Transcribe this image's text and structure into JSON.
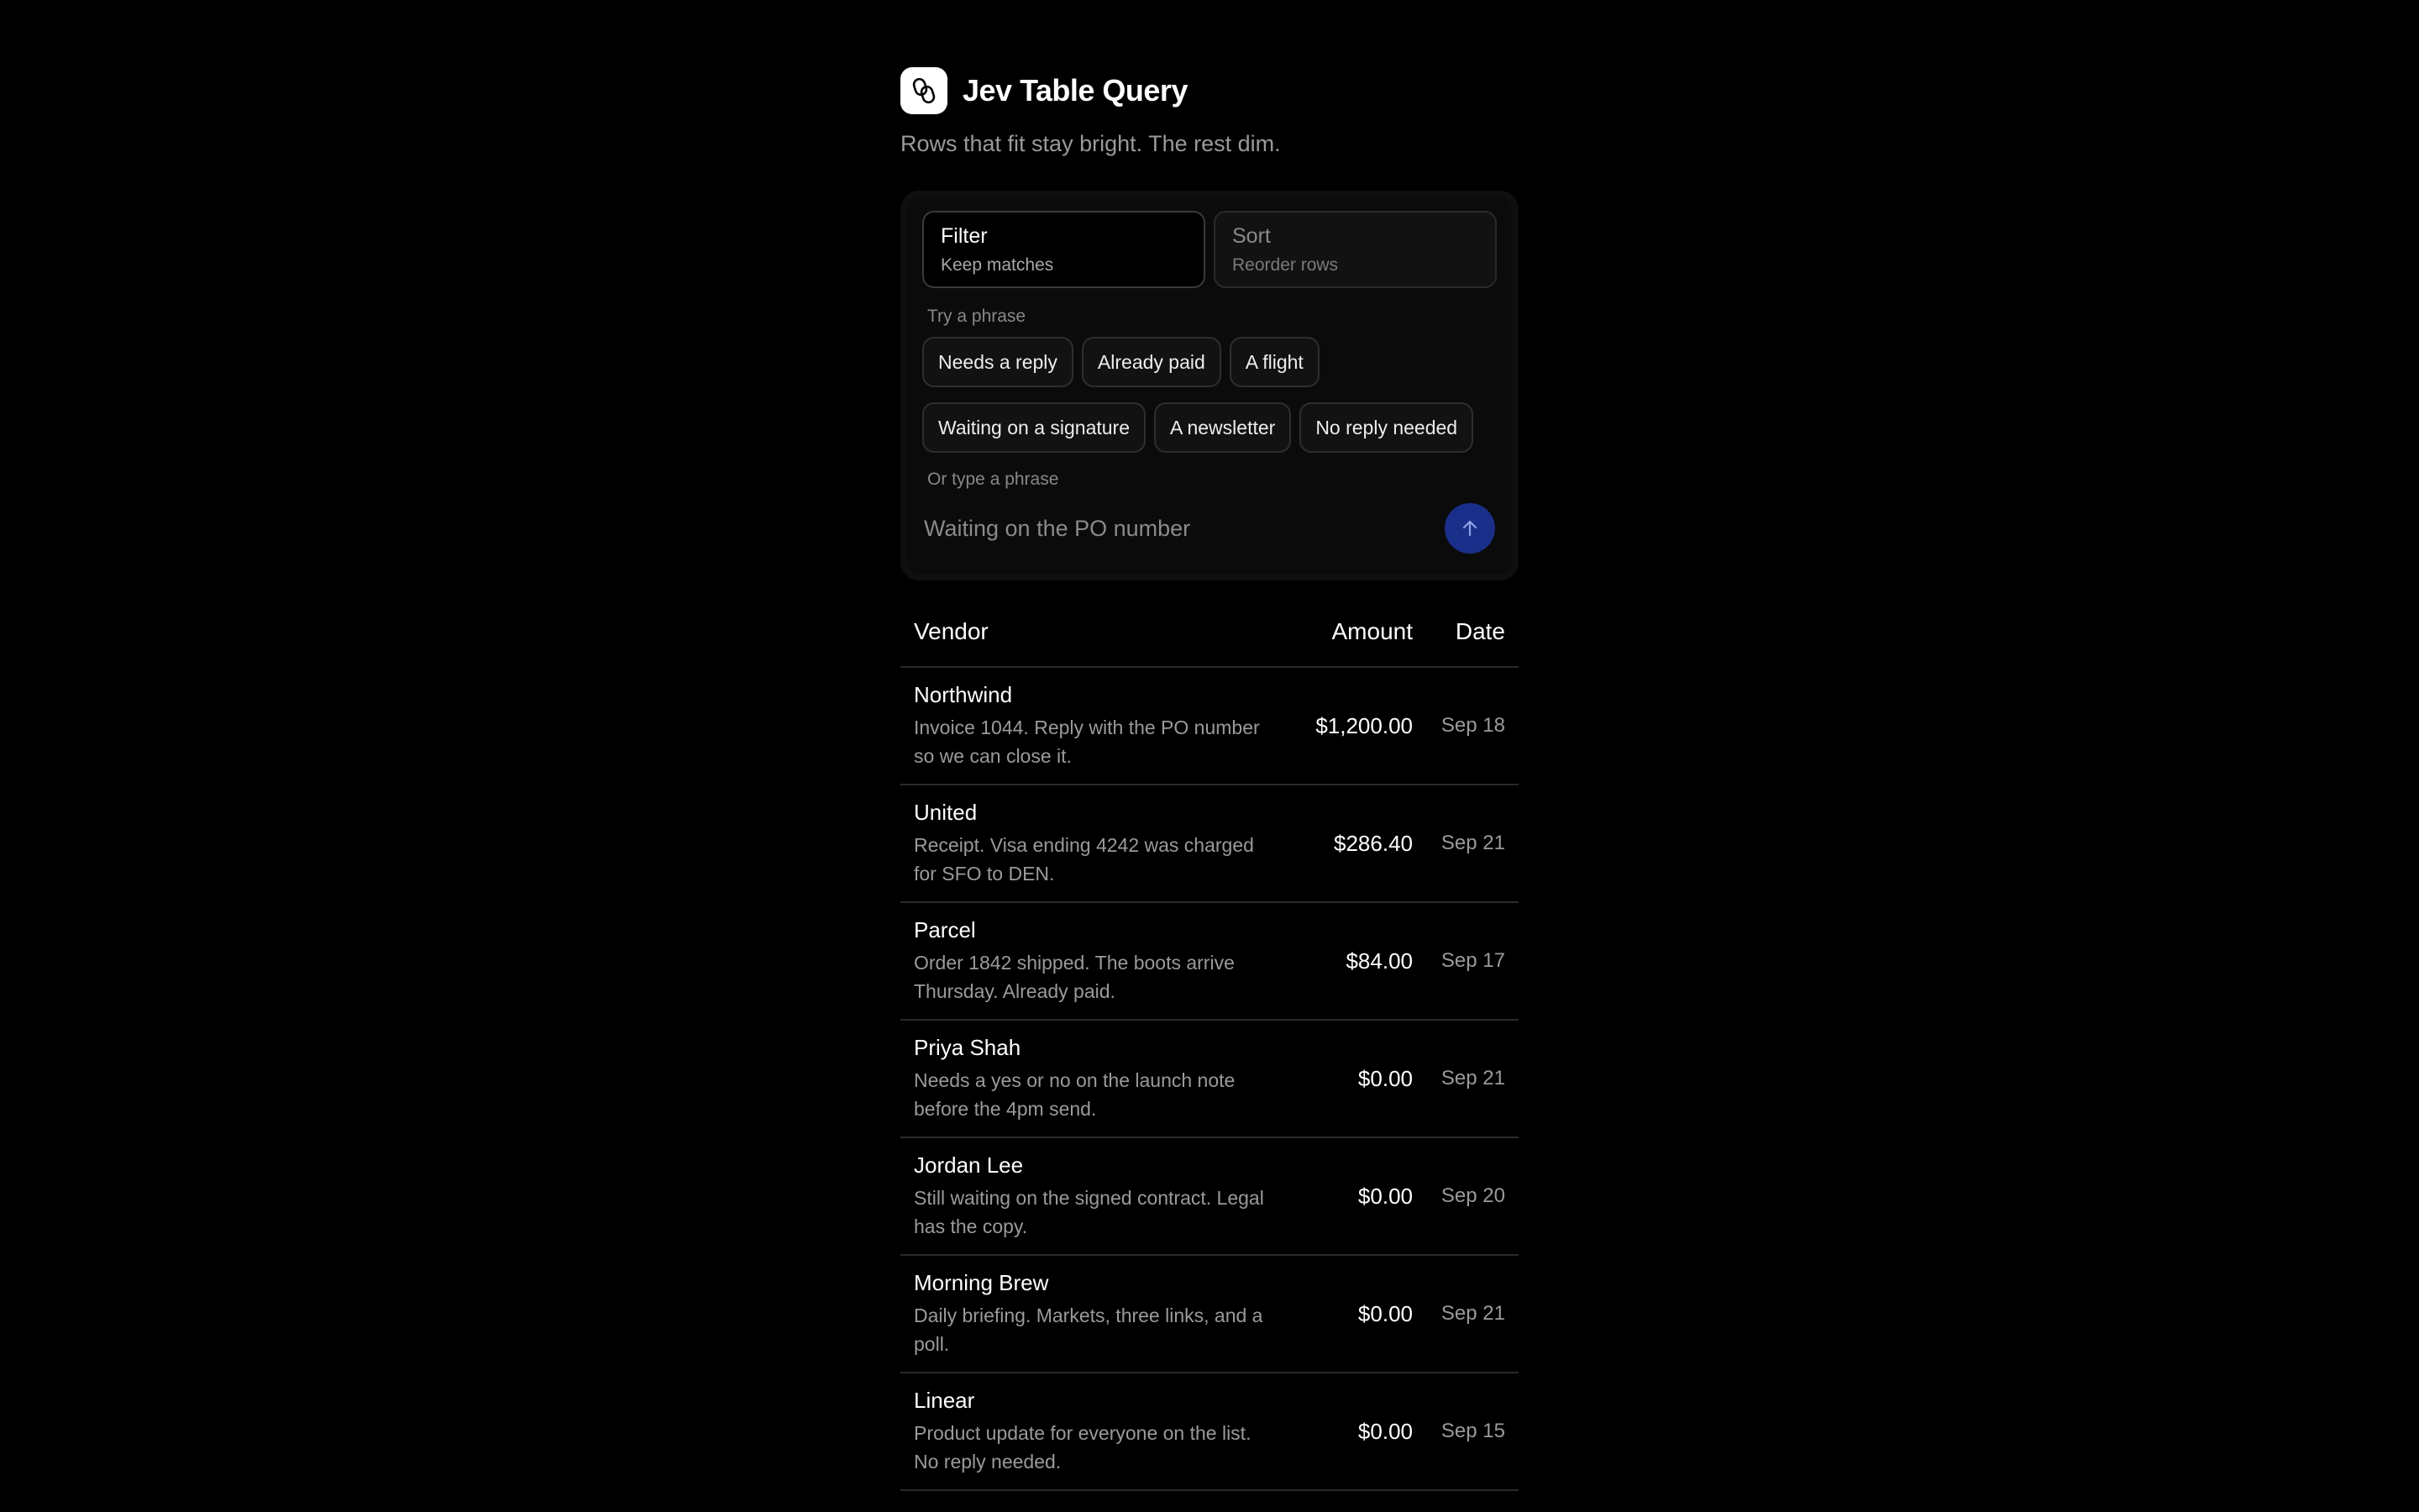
{
  "app": {
    "title": "Jev Table Query",
    "subtitle": "Rows that fit stay bright. The rest dim.",
    "logo_icon": "link-icon"
  },
  "modes": [
    {
      "label": "Filter",
      "sub": "Keep matches",
      "active": true
    },
    {
      "label": "Sort",
      "sub": "Reorder rows",
      "active": false
    }
  ],
  "phrases": {
    "label": "Try a phrase",
    "row1": [
      "Needs a reply",
      "Already paid",
      "A flight"
    ],
    "row2": [
      "Waiting on a signature",
      "A newsletter",
      "No reply needed"
    ]
  },
  "input": {
    "label": "Or type a phrase",
    "placeholder": "Waiting on the PO number",
    "value": "",
    "send_icon": "arrow-up-icon",
    "send_color": "#1a2f8a"
  },
  "table": {
    "headers": {
      "vendor": "Vendor",
      "amount": "Amount",
      "date": "Date"
    },
    "rows": [
      {
        "vendor": "Northwind",
        "desc": "Invoice 1044. Reply with the PO number so we can close it.",
        "amount": "$1,200.00",
        "date": "Sep 18"
      },
      {
        "vendor": "United",
        "desc": "Receipt. Visa ending 4242 was charged for SFO to DEN.",
        "amount": "$286.40",
        "date": "Sep 21"
      },
      {
        "vendor": "Parcel",
        "desc": "Order 1842 shipped. The boots arrive Thursday. Already paid.",
        "amount": "$84.00",
        "date": "Sep 17"
      },
      {
        "vendor": "Priya Shah",
        "desc": "Needs a yes or no on the launch note before the 4pm send.",
        "amount": "$0.00",
        "date": "Sep 21"
      },
      {
        "vendor": "Jordan Lee",
        "desc": "Still waiting on the signed contract. Legal has the copy.",
        "amount": "$0.00",
        "date": "Sep 20"
      },
      {
        "vendor": "Morning Brew",
        "desc": "Daily briefing. Markets, three links, and a poll.",
        "amount": "$0.00",
        "date": "Sep 21"
      },
      {
        "vendor": "Linear",
        "desc": "Product update for everyone on the list. No reply needed.",
        "amount": "$0.00",
        "date": "Sep 15"
      }
    ]
  }
}
